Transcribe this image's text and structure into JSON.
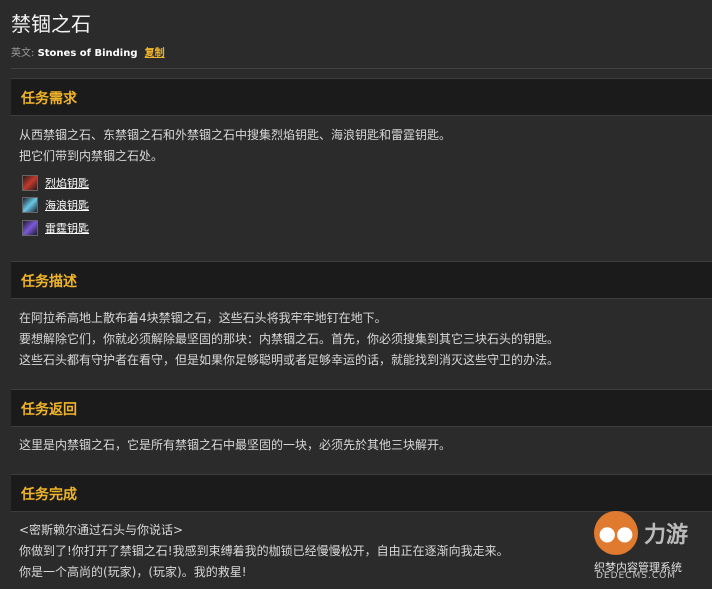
{
  "page": {
    "title": "禁锢之石",
    "english_label": "英文:",
    "english_name": "Stones of Binding",
    "copy_label": "复制"
  },
  "sections": {
    "requirements": {
      "title": "任务需求",
      "lines": [
        "从西禁锢之石、东禁锢之石和外禁锢之石中搜集烈焰钥匙、海浪钥匙和雷霆钥匙。",
        "把它们带到内禁锢之石处。"
      ],
      "items": [
        {
          "label": "烈焰钥匙",
          "icon": "red-key-icon",
          "color": "#c23a2c"
        },
        {
          "label": "海浪钥匙",
          "icon": "blue-key-icon",
          "color": "#6ac7e6"
        },
        {
          "label": "雷霆钥匙",
          "icon": "purple-key-icon",
          "color": "#7d58d8"
        }
      ]
    },
    "description": {
      "title": "任务描述",
      "lines": [
        "在阿拉希高地上散布着4块禁锢之石，这些石头将我牢牢地钉在地下。",
        "要想解除它们，你就必须解除最坚固的那块：内禁锢之石。首先，你必须搜集到其它三块石头的钥匙。",
        "这些石头都有守护者在看守，但是如果你足够聪明或者足够幸运的话，就能找到消灭这些守卫的办法。"
      ]
    },
    "return": {
      "title": "任务返回",
      "lines": [
        "这里是内禁锢之石，它是所有禁锢之石中最坚固的一块，必须先於其他三块解开。"
      ]
    },
    "completion": {
      "title": "任务完成",
      "lines": [
        "<密斯赖尔通过石头与你说话>",
        "你做到了!你打开了禁锢之石!我感到束缚着我的枷锁已经慢慢松开，自由正在逐渐向我走来。",
        "你是一个高尚的(玩家)，(玩家)。我的救星!"
      ]
    }
  },
  "watermark": {
    "brand": "力游",
    "line1": "织梦内容管理系统",
    "line2": "DEDECMS.COM"
  },
  "colors": {
    "accent": "#f0b429",
    "background": "#2b2b2b",
    "header_bg": "#1b1b1b"
  }
}
